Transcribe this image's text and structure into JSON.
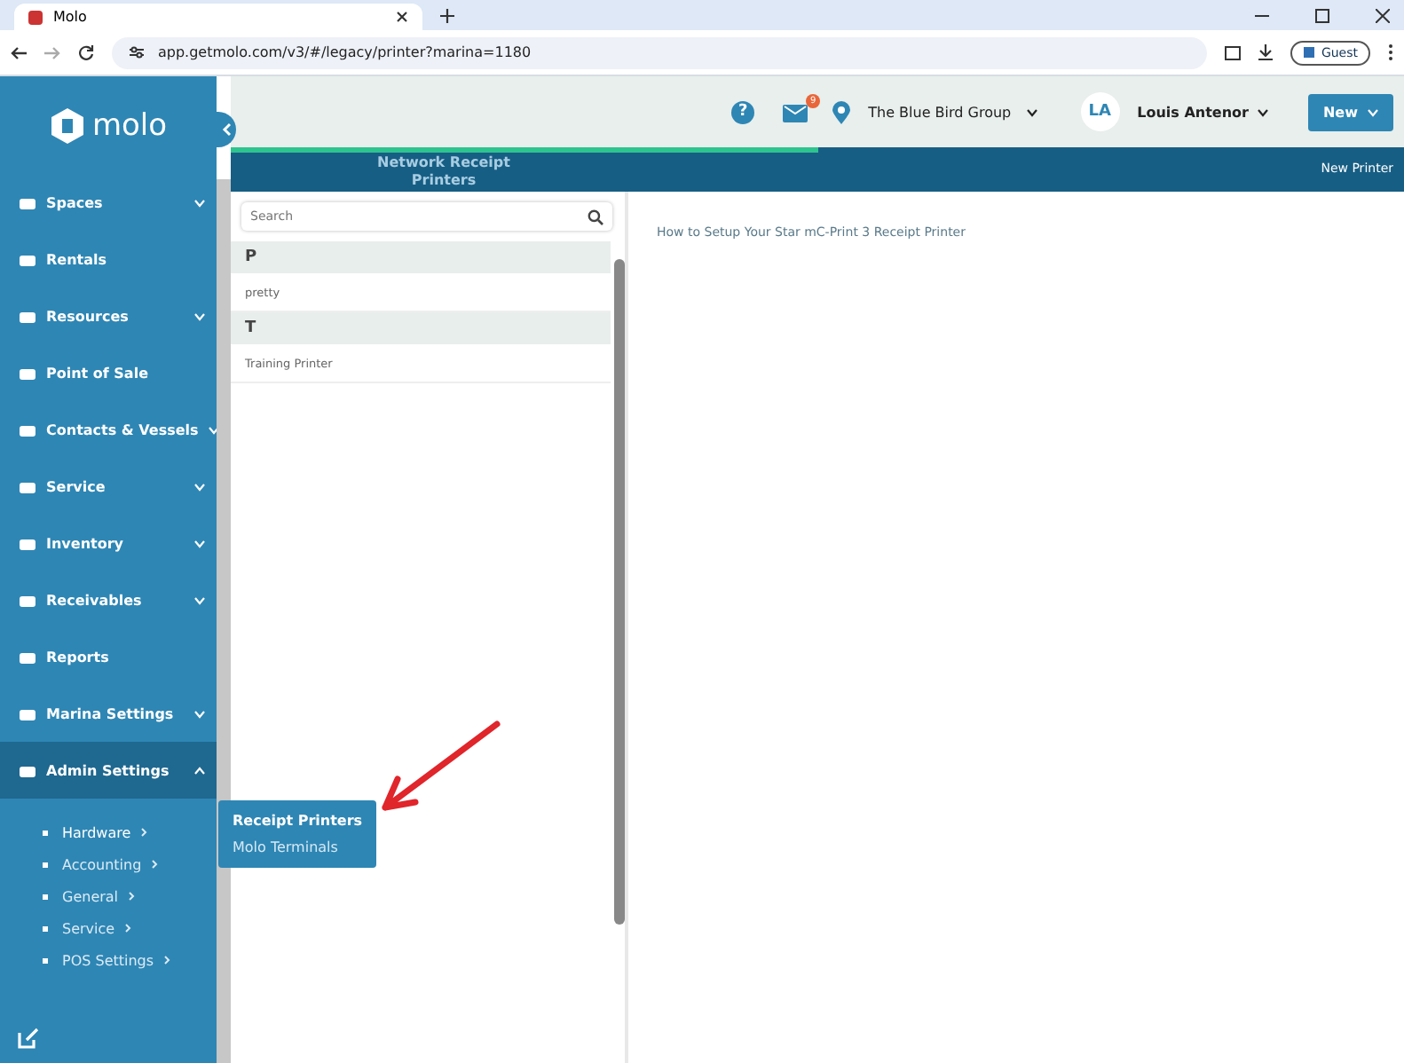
{
  "browser": {
    "tab_title": "Molo",
    "url": "app.getmolo.com/v3/#/legacy/printer?marina=1180",
    "profile": "Guest"
  },
  "header": {
    "help_glyph": "?",
    "notification_count": "9",
    "location": "The Blue Bird Group",
    "avatar_initials": "LA",
    "user_name": "Louis Antenor",
    "new_button": "New"
  },
  "sidebar": {
    "logo_text": "molo",
    "items": [
      {
        "label": "Spaces",
        "kind": "menu",
        "expanded": false
      },
      {
        "label": "Rentals",
        "kind": "link"
      },
      {
        "label": "Resources",
        "kind": "menu",
        "expanded": false
      },
      {
        "label": "Point of Sale",
        "kind": "link"
      },
      {
        "label": "Contacts & Vessels",
        "kind": "menu",
        "expanded": false
      },
      {
        "label": "Service",
        "kind": "menu",
        "expanded": false
      },
      {
        "label": "Inventory",
        "kind": "menu",
        "expanded": false
      },
      {
        "label": "Receivables",
        "kind": "menu",
        "expanded": false
      },
      {
        "label": "Reports",
        "kind": "link"
      },
      {
        "label": "Marina Settings",
        "kind": "menu",
        "expanded": false
      },
      {
        "label": "Admin Settings",
        "kind": "menu",
        "expanded": true,
        "children": [
          {
            "label": "Hardware",
            "selected": true
          },
          {
            "label": "Accounting",
            "selected": false
          },
          {
            "label": "General",
            "selected": false
          },
          {
            "label": "Service",
            "selected": false
          },
          {
            "label": "POS Settings",
            "selected": false
          }
        ]
      }
    ]
  },
  "flyout": {
    "items": [
      {
        "label": "Receipt Printers",
        "selected": true
      },
      {
        "label": "Molo Terminals",
        "selected": false
      }
    ]
  },
  "page": {
    "title": "Network Receipt Printers",
    "new_printer": "New Printer",
    "loading": {
      "level": 0.5
    }
  },
  "printer_list": {
    "search": {
      "placeholder": "Search"
    },
    "groups": [
      {
        "letter": "P",
        "items": [
          "pretty"
        ]
      },
      {
        "letter": "T",
        "items": [
          "Training Printer"
        ]
      }
    ]
  },
  "detail": {
    "help_link": "How to Setup Your Star mC-Print 3 Receipt Printer"
  }
}
